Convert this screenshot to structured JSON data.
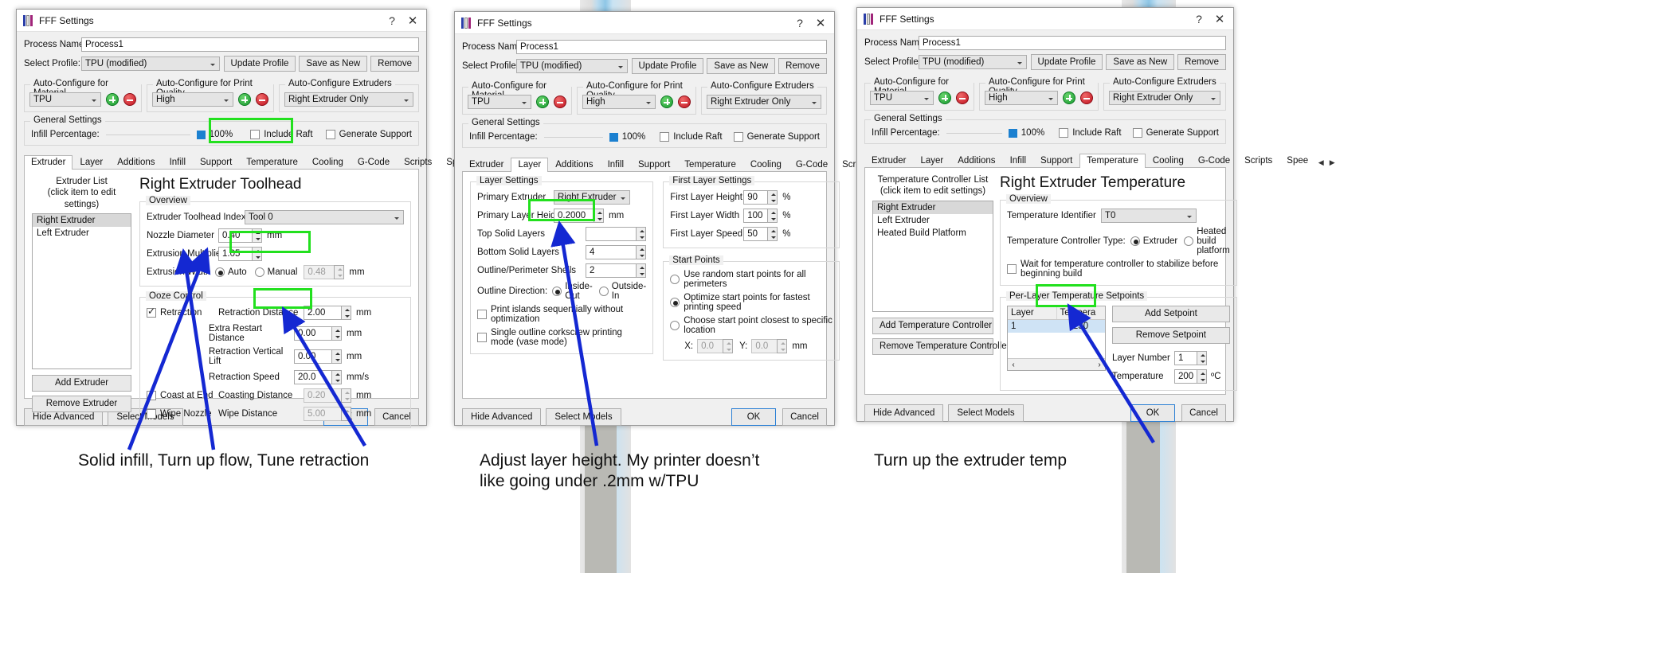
{
  "window": {
    "title": "FFF Settings",
    "help_glyph": "?",
    "close_glyph": "✕"
  },
  "form": {
    "process_name_label": "Process Name:",
    "process_name_value": "Process1",
    "select_profile_label": "Select Profile:",
    "select_profile_value": "TPU (modified)",
    "update_profile_btn": "Update Profile",
    "save_as_new_btn": "Save as New",
    "remove_btn": "Remove",
    "auto_material_legend": "Auto-Configure for Material",
    "auto_material_value": "TPU",
    "auto_quality_legend": "Auto-Configure for Print Quality",
    "auto_quality_value": "High",
    "auto_extruders_legend": "Auto-Configure Extruders",
    "auto_extruders_value": "Right Extruder Only",
    "general_settings_legend": "General Settings",
    "infill_label": "Infill Percentage:",
    "infill_value": "100%",
    "include_raft_label": "Include Raft",
    "generate_support_label": "Generate Support"
  },
  "tabs": [
    "Extruder",
    "Layer",
    "Additions",
    "Infill",
    "Support",
    "Temperature",
    "Cooling",
    "G-Code",
    "Scripts",
    "Spee"
  ],
  "tab_nav": {
    "prev": "◀",
    "next": "▶"
  },
  "footer": {
    "hide_advanced": "Hide Advanced",
    "select_models": "Select Models",
    "ok": "OK",
    "cancel": "Cancel"
  },
  "dialog1": {
    "active_tab": "Extruder",
    "list_title_line1": "Extruder List",
    "list_title_line2": "(click item to edit settings)",
    "list_items": [
      "Right Extruder",
      "Left Extruder"
    ],
    "list_selected": "Right Extruder",
    "add_button": "Add Extruder",
    "remove_button": "Remove Extruder",
    "heading": "Right Extruder Toolhead",
    "overview_legend": "Overview",
    "toolhead_index_label": "Extruder Toolhead Index",
    "toolhead_index_value": "Tool 0",
    "nozzle_diameter_label": "Nozzle Diameter",
    "nozzle_diameter_value": "0.40",
    "nozzle_diameter_unit": "mm",
    "extrusion_multiplier_label": "Extrusion Multiplier",
    "extrusion_multiplier_value": "1.05",
    "extrusion_width_label": "Extrusion Width",
    "extrusion_width_auto": "Auto",
    "extrusion_width_manual": "Manual",
    "extrusion_width_value": "0.48",
    "extrusion_width_unit": "mm",
    "ooze_legend": "Ooze Control",
    "retraction_label": "Retraction",
    "retraction_distance_label": "Retraction Distance",
    "retraction_distance_value": "2.00",
    "retraction_distance_unit": "mm",
    "extra_restart_label": "Extra Restart Distance",
    "extra_restart_value": "0.00",
    "extra_restart_unit": "mm",
    "vertical_lift_label": "Retraction Vertical Lift",
    "vertical_lift_value": "0.00",
    "vertical_lift_unit": "mm",
    "retraction_speed_label": "Retraction Speed",
    "retraction_speed_value": "20.0",
    "retraction_speed_unit": "mm/s",
    "coast_at_end_label": "Coast at End",
    "coasting_distance_label": "Coasting Distance",
    "coasting_distance_value": "0.20",
    "coasting_distance_unit": "mm",
    "wipe_nozzle_label": "Wipe Nozzle",
    "wipe_distance_label": "Wipe Distance",
    "wipe_distance_value": "5.00",
    "wipe_distance_unit": "mm"
  },
  "dialog2": {
    "active_tab": "Layer",
    "layer_settings_legend": "Layer Settings",
    "primary_extruder_label": "Primary Extruder",
    "primary_extruder_value": "Right Extruder",
    "primary_layer_height_label": "Primary Layer Height",
    "primary_layer_height_value": "0.2000",
    "primary_layer_height_unit": "mm",
    "top_solid_layers_label": "Top Solid Layers",
    "top_solid_layers_value": "",
    "bottom_solid_layers_label": "Bottom Solid Layers",
    "bottom_solid_layers_value": "4",
    "outline_shells_label": "Outline/Perimeter Shells",
    "outline_shells_value": "2",
    "outline_direction_label": "Outline Direction:",
    "outline_inside_out": "Inside-Out",
    "outline_outside_in": "Outside-In",
    "print_islands_label": "Print islands sequentially without optimization",
    "single_outline_label": "Single outline corkscrew printing mode (vase mode)",
    "first_layer_legend": "First Layer Settings",
    "first_layer_height_label": "First Layer Height",
    "first_layer_height_value": "90",
    "first_layer_height_unit": "%",
    "first_layer_width_label": "First Layer Width",
    "first_layer_width_value": "100",
    "first_layer_width_unit": "%",
    "first_layer_speed_label": "First Layer Speed",
    "first_layer_speed_value": "50",
    "first_layer_speed_unit": "%",
    "start_points_legend": "Start Points",
    "start_random": "Use random start points for all perimeters",
    "start_optimize": "Optimize start points for fastest printing speed",
    "start_closest": "Choose start point closest to specific location",
    "start_x_label": "X:",
    "start_x_value": "0.0",
    "start_y_label": "Y:",
    "start_y_value": "0.0",
    "start_unit": "mm"
  },
  "dialog3": {
    "active_tab": "Temperature",
    "list_title_line1": "Temperature Controller List",
    "list_title_line2": "(click item to edit settings)",
    "list_items": [
      "Right Extruder",
      "Left Extruder",
      "Heated Build Platform"
    ],
    "list_selected": "Right Extruder",
    "add_button": "Add Temperature Controller",
    "remove_button": "Remove Temperature Controller",
    "heading": "Right Extruder Temperature",
    "overview_legend": "Overview",
    "identifier_label": "Temperature Identifier",
    "identifier_value": "T0",
    "controller_type_label": "Temperature Controller Type:",
    "controller_type_extruder": "Extruder",
    "controller_type_bed": "Heated build platform",
    "wait_label": "Wait for temperature controller to stabilize before beginning build",
    "setpoints_legend": "Per-Layer Temperature Setpoints",
    "table_headers": [
      "Layer",
      "Tempera"
    ],
    "table_rows": [
      [
        "1",
        "230"
      ]
    ],
    "add_setpoint_btn": "Add Setpoint",
    "remove_setpoint_btn": "Remove Setpoint",
    "layer_number_label": "Layer Number",
    "layer_number_value": "1",
    "temperature_label": "Temperature",
    "temperature_value": "200",
    "temperature_unit": "ºC",
    "scroll_left": "‹",
    "scroll_right": "›"
  },
  "captions": {
    "one": "Solid infill, Turn up flow, Tune retraction",
    "two_line1": "Adjust layer height. My printer doesn’t",
    "two_line2": "like going under .2mm w/TPU",
    "three": "Turn up the extruder temp"
  },
  "colors": {
    "highlight": "#22e01e",
    "arrow": "#1428d2",
    "infill_swatch": "#1b80d0",
    "selection": "#d8d8d8"
  }
}
